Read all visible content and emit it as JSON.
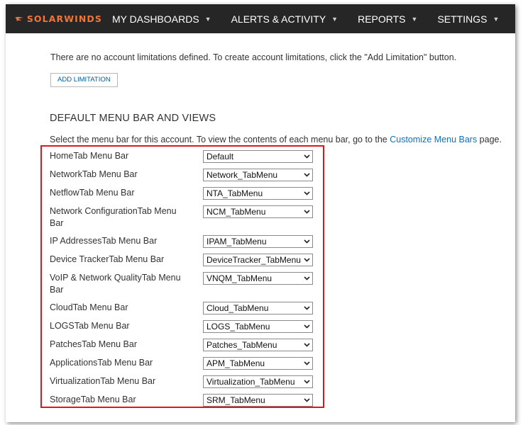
{
  "brand": {
    "name": "SOLARWINDS",
    "color": "#f27536"
  },
  "nav": [
    {
      "label": "MY DASHBOARDS",
      "icon": "chevron-down-icon"
    },
    {
      "label": "ALERTS & ACTIVITY",
      "icon": "chevron-down-icon"
    },
    {
      "label": "REPORTS",
      "icon": "chevron-down-icon"
    },
    {
      "label": "SETTINGS",
      "icon": "chevron-down-icon"
    }
  ],
  "limits": {
    "message": "There are no account limitations defined. To create account limitations, click the \"Add Limitation\" button.",
    "add_button": "ADD LIMITATION"
  },
  "menu_section": {
    "title": "DEFAULT MENU BAR AND VIEWS",
    "description_prefix": "Select the menu bar for this account. To view the contents of each menu bar, go to the ",
    "link": "Customize Menu Bars",
    "description_suffix": " page.",
    "highlight_color": "#e0161d",
    "rows": [
      {
        "label": "HomeTab Menu Bar",
        "value": "Default"
      },
      {
        "label": "NetworkTab Menu Bar",
        "value": "Network_TabMenu"
      },
      {
        "label": "NetflowTab Menu Bar",
        "value": "NTA_TabMenu"
      },
      {
        "label": "Network ConfigurationTab Menu Bar",
        "value": "NCM_TabMenu"
      },
      {
        "label": "IP AddressesTab Menu Bar",
        "value": "IPAM_TabMenu"
      },
      {
        "label": "Device TrackerTab Menu Bar",
        "value": "DeviceTracker_TabMenu"
      },
      {
        "label": "VoIP & Network QualityTab Menu Bar",
        "value": "VNQM_TabMenu"
      },
      {
        "label": "CloudTab Menu Bar",
        "value": "Cloud_TabMenu"
      },
      {
        "label": "LOGSTab Menu Bar",
        "value": "LOGS_TabMenu"
      },
      {
        "label": "PatchesTab Menu Bar",
        "value": "Patches_TabMenu"
      },
      {
        "label": "ApplicationsTab Menu Bar",
        "value": "APM_TabMenu"
      },
      {
        "label": "VirtualizationTab Menu Bar",
        "value": "Virtualization_TabMenu"
      },
      {
        "label": "StorageTab Menu Bar",
        "value": "SRM_TabMenu"
      }
    ]
  }
}
